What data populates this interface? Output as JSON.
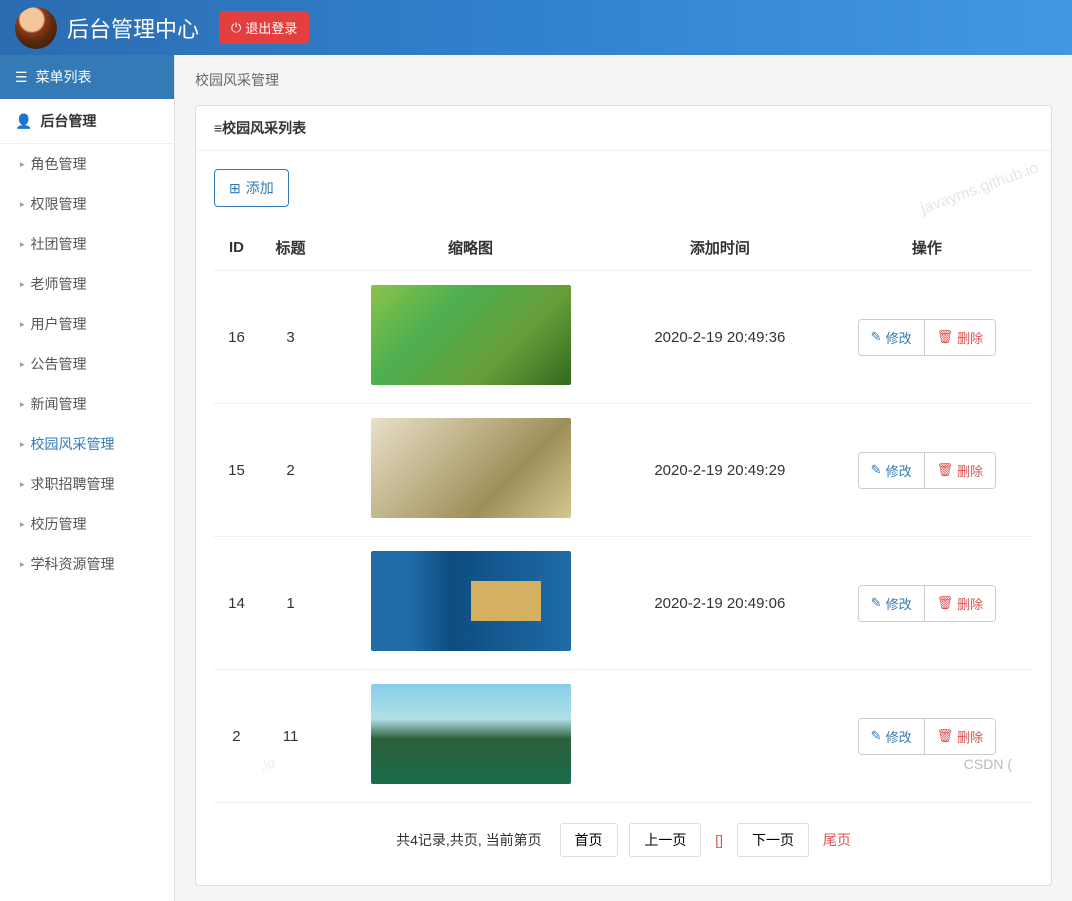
{
  "header": {
    "title": "后台管理中心",
    "logout": "退出登录"
  },
  "sidebar": {
    "menu_header": "菜单列表",
    "section": "后台管理",
    "items": [
      {
        "label": "角色管理",
        "active": false
      },
      {
        "label": "权限管理",
        "active": false
      },
      {
        "label": "社团管理",
        "active": false
      },
      {
        "label": "老师管理",
        "active": false
      },
      {
        "label": "用户管理",
        "active": false
      },
      {
        "label": "公告管理",
        "active": false
      },
      {
        "label": "新闻管理",
        "active": false
      },
      {
        "label": "校园风采管理",
        "active": true
      },
      {
        "label": "求职招聘管理",
        "active": false
      },
      {
        "label": "校历管理",
        "active": false
      },
      {
        "label": "学科资源管理",
        "active": false
      }
    ]
  },
  "breadcrumb": "校园风采管理",
  "panel": {
    "title": "≡校园风采列表",
    "add_label": "添加"
  },
  "table": {
    "headers": {
      "id": "ID",
      "title": "标题",
      "thumb": "缩略图",
      "time": "添加时间",
      "ops": "操作"
    },
    "edit_label": "修改",
    "del_label": "删除",
    "rows": [
      {
        "id": "16",
        "title": "3",
        "time": "2020-2-19 20:49:36",
        "thumb": "t1"
      },
      {
        "id": "15",
        "title": "2",
        "time": "2020-2-19 20:49:29",
        "thumb": "t2"
      },
      {
        "id": "14",
        "title": "1",
        "time": "2020-2-19 20:49:06",
        "thumb": "t3"
      },
      {
        "id": "2",
        "title": "11",
        "time": "",
        "thumb": "t4"
      }
    ]
  },
  "pagination": {
    "summary": "共4记录,共页, 当前第页",
    "first": "首页",
    "prev": "上一页",
    "current": "[]",
    "next": "下一页",
    "last": "尾页"
  },
  "watermarks": {
    "w1": "javayms.github.io",
    "w2": "CSDN (",
    "w3": ".io"
  }
}
